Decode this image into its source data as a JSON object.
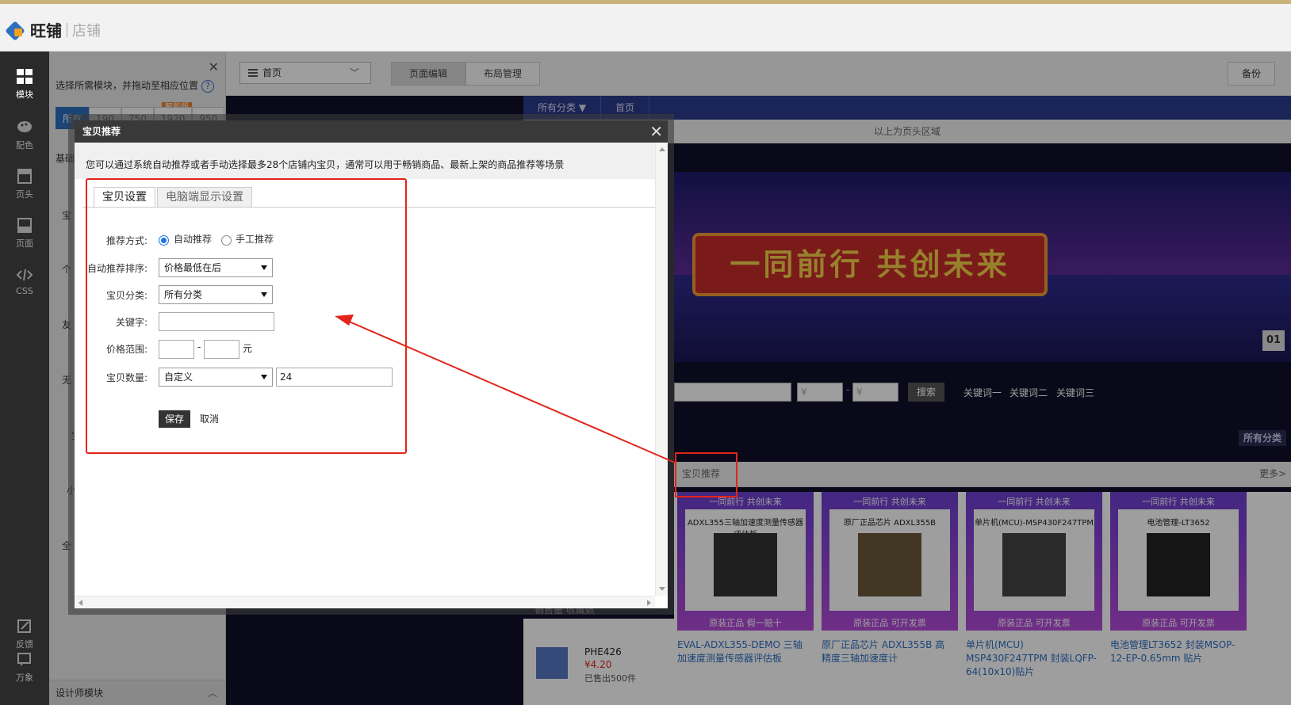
{
  "app": {
    "logo_text": "旺铺",
    "logo_sub": "店铺"
  },
  "rail": {
    "items": [
      {
        "label": "模块",
        "icon": "grid-icon"
      },
      {
        "label": "配色",
        "icon": "palette-icon"
      },
      {
        "label": "页头",
        "icon": "header-icon"
      },
      {
        "label": "页面",
        "icon": "page-icon"
      },
      {
        "label": "CSS",
        "icon": "code-icon"
      },
      {
        "label": "反馈",
        "icon": "feedback-icon"
      },
      {
        "label": "万象",
        "icon": "chat-icon"
      }
    ]
  },
  "modules": {
    "hint": "选择所需模块，并拖动至相应位置",
    "filters": [
      "所有",
      "190",
      "750",
      "1920",
      "950"
    ],
    "smart_badge": "智能版",
    "section_labels": [
      "基础",
      "宝",
      "个",
      "友",
      "无",
      "宝",
      "小",
      "全"
    ],
    "footer": "设计师模块"
  },
  "toolbar": {
    "page_select": "首页",
    "tab_edit": "页面编辑",
    "tab_layout": "布局管理",
    "backup": "备份"
  },
  "canvas": {
    "nav_category": "所有分类 ▼",
    "nav_home": "首页",
    "head_area_note": "以上为页头区域",
    "banner_slogan": "一同前行 共创未来",
    "banner_index": "01",
    "search": {
      "price_from": "¥",
      "price_to": "¥",
      "button": "搜索",
      "keywords": [
        "关键词一",
        "关键词二",
        "关键词三"
      ]
    },
    "all_category": "所有分类",
    "rec_title": "宝贝推荐",
    "more": "更多>",
    "sales_tabs": "销售量  收藏数",
    "mini_product": {
      "name": "PHE426",
      "price": "¥4.20",
      "sold": "已售出500件"
    },
    "products": [
      {
        "tag": "一同前行 共创未来",
        "caption": "ADXL355三轴加速度测量传感器评估板",
        "bottom": "原装正品  假一赔十",
        "name": "EVAL-ADXL355-DEMO 三轴加速度测量传感器评估板"
      },
      {
        "tag": "一同前行 共创未来",
        "caption": "原厂正品芯片 ADXL355B",
        "bottom": "原装正品  可开发票",
        "name": "原厂正品芯片 ADXL355B 高精度三轴加速度计"
      },
      {
        "tag": "一同前行 共创未来",
        "caption": "单片机(MCU)-MSP430F247TPM",
        "bottom": "原装正品  可开发票",
        "name": "单片机(MCU) MSP430F247TPM 封装LQFP-64(10x10)贴片"
      },
      {
        "tag": "一同前行 共创未来",
        "caption": "电池管理-LT3652",
        "bottom": "原装正品  可开发票",
        "name": "电池管理LT3652 封装MSOP-12-EP-0.65mm 贴片"
      }
    ]
  },
  "dialog": {
    "title": "宝贝推荐",
    "description": "您可以通过系统自动推荐或者手动选择最多28个店铺内宝贝，通常可以用于畅销商品、最新上架的商品推荐等场景",
    "tabs": [
      "宝贝设置",
      "电脑端显示设置"
    ],
    "fields": {
      "mode_label": "推荐方式:",
      "mode_auto": "自动推荐",
      "mode_manual": "手工推荐",
      "sort_label": "自动推荐排序:",
      "sort_value": "价格最低在后",
      "category_label": "宝贝分类:",
      "category_value": "所有分类",
      "keyword_label": "关键字:",
      "keyword_value": "",
      "price_label": "价格范围:",
      "price_min": "",
      "price_max": "",
      "price_sep": "-",
      "price_unit": "元",
      "count_label": "宝贝数量:",
      "count_mode": "自定义",
      "count_value": "24"
    },
    "save": "保存",
    "cancel": "取消"
  }
}
